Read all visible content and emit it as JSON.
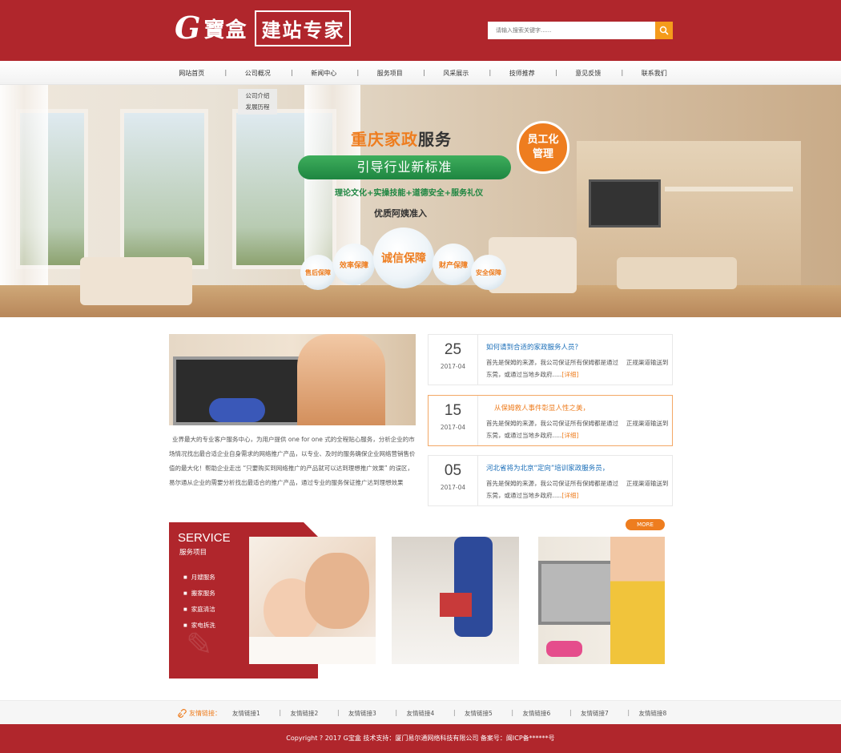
{
  "header": {
    "logo_mark": "G",
    "logo_cn": "寶盒",
    "logo_tag": "建站专家",
    "search_placeholder": "请输入搜索关键字......"
  },
  "nav": {
    "items": [
      "网站首页",
      "公司概况",
      "新闻中心",
      "服务项目",
      "风采展示",
      "技师推荐",
      "意见反馈",
      "联系我们"
    ],
    "dropdown": [
      "公司介绍",
      "发展历程"
    ]
  },
  "banner": {
    "title_hl": "重庆家政",
    "title_rest": "服务",
    "pill": "引导行业新标准",
    "badge_line1": "员工化",
    "badge_line2": "管理",
    "sub": "理论文化+实操技能+道德安全+服务礼仪",
    "sub2": "优质阿姨准入",
    "bubbles": [
      "售后保障",
      "效率保障",
      "诚信保障",
      "财产保障",
      "安全保障"
    ]
  },
  "feature": {
    "text": "业界最大的专业客户服务中心，为用户提供 one for one 式的全程贴心服务，分析企业的市场情况找出最合适企业自身需求的网络推广产品，以专业、及时的服务确保企业网络营销售价值的最大化！帮助企业走出 “只要购买到网络推广的产品就可以达到理想推广效果” 的误区，易尔通从企业的需要分析找出最适合的推广产品，通过专业的服务保证推广达到理想效果"
  },
  "news": [
    {
      "day": "25",
      "ym": "2017-04",
      "title": "如何请到合适的家政服务人员？",
      "desc": "首先是保姆的来源，我公司保证所有保姆都是通过　 正规渠道输送到东莞，或通过当地乡政府.....",
      "more": "[详细]"
    },
    {
      "day": "15",
      "ym": "2017-04",
      "title": "从保姆救人事件彰显人性之美，",
      "desc": "首先是保姆的来源，我公司保证所有保姆都是通过　 正规渠道输送到东莞，或通过当地乡政府.....",
      "more": "[详细]"
    },
    {
      "day": "05",
      "ym": "2017-04",
      "title": "河北省将为北京“定向”培训家政服务员，",
      "desc": "首先是保姆的来源，我公司保证所有保姆都是通过　 正规渠道输送到东莞，或通过当地乡政府.....",
      "more": "[详细]"
    }
  ],
  "service": {
    "en": "SERVICE",
    "cn": "服务项目",
    "more": "MORE",
    "items": [
      "月嫂服务",
      "搬家服务",
      "家庭清洁",
      "家电拆洗"
    ]
  },
  "links": {
    "label": "友情链接：",
    "items": [
      "友情链接1",
      "友情链接2",
      "友情链接3",
      "友情链接4",
      "友情链接5",
      "友情链接6",
      "友情链接7",
      "友情链接8"
    ]
  },
  "footer": {
    "text": "Copyright ? 2017 G宝盒 技术支持：厦门易尔通网络科技有限公司 备案号：闽ICP备******号"
  },
  "colors": {
    "brand_red": "#b0262c",
    "accent_orange": "#ee7d1f",
    "green": "#1e8641",
    "link_blue": "#1a6eb8"
  },
  "icons": {
    "search": "search-icon",
    "links": "link-icon",
    "broom": "broom-icon"
  }
}
